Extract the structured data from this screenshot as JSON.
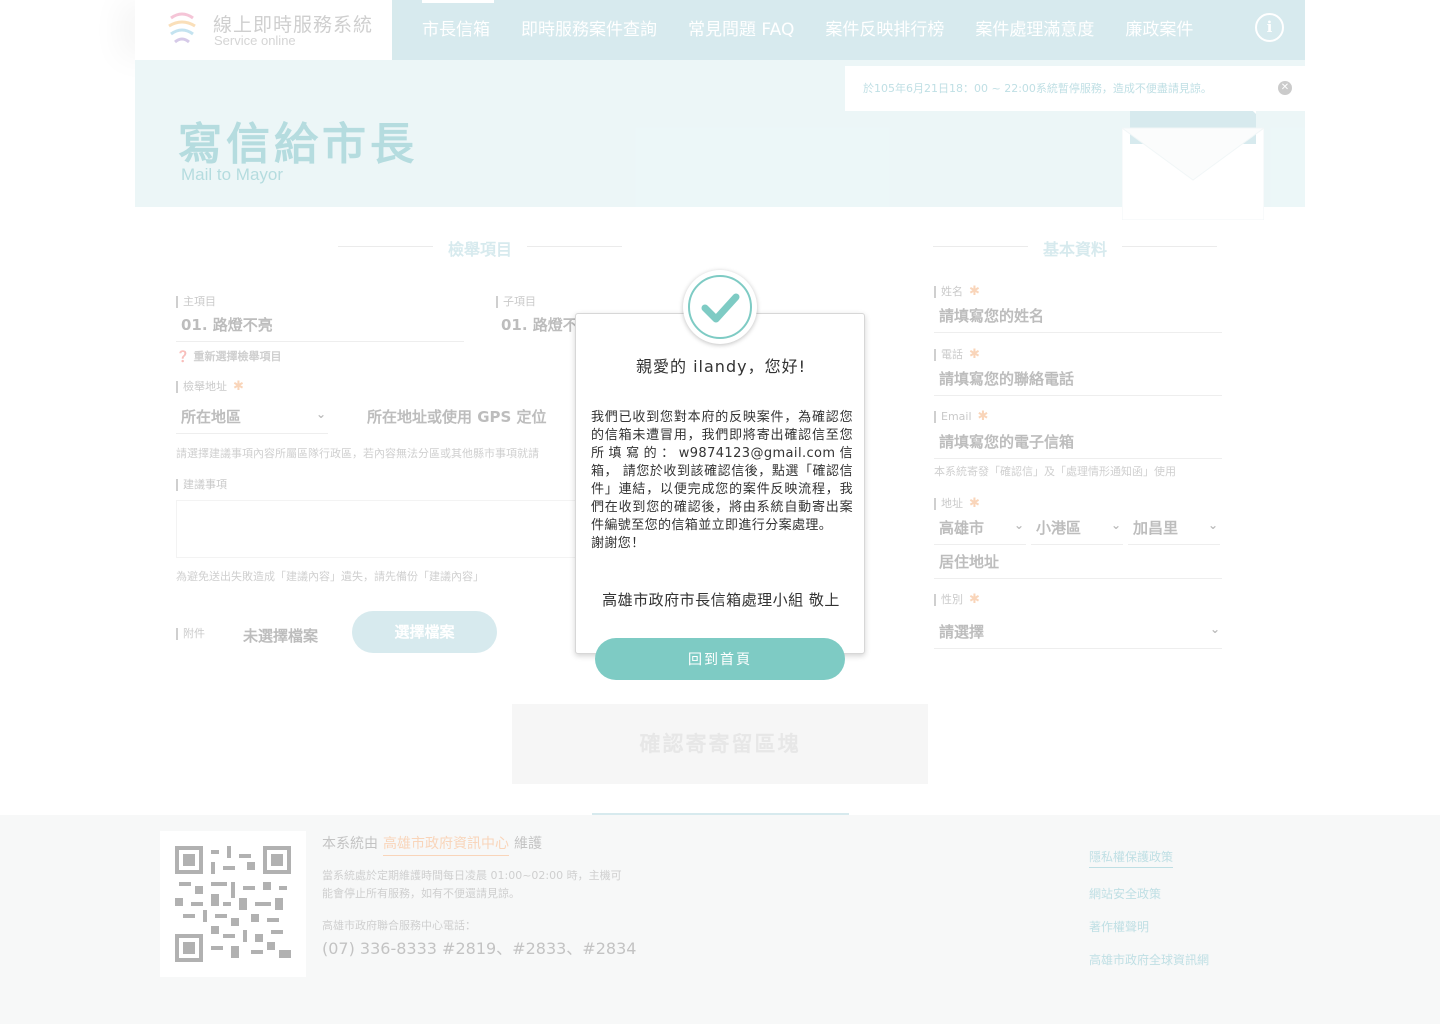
{
  "header": {
    "logo_title": "線上即時服務系統",
    "logo_sub": "Service online",
    "nav": [
      "市長信箱",
      "即時服務案件查詢",
      "常見問題 FAQ",
      "案件反映排行榜",
      "案件處理滿意度",
      "廉政案件"
    ],
    "info_icon": "i"
  },
  "hero": {
    "title": "寫信給市長",
    "subtitle": "Mail to Mayor",
    "notice": "於105年6月21日18：00 ~ 22:00系統暫停服務，造成不便盡請見諒。"
  },
  "form": {
    "left_section": "檢舉項目",
    "right_section": "基本資料",
    "main_item_label": "主項目",
    "main_item_value": "01. 路燈不亮",
    "sub_item_label": "子項目",
    "sub_item_value": "01. 路燈不",
    "reselect": "重新選擇檢舉項目",
    "address_label": "檢舉地址",
    "district_select": "所在地區",
    "gps_text": "所在地址或使用 GPS 定位",
    "address_note": "請選擇建議事項內容所屬區隊行政區，若內容無法分區或其他縣市事項就請",
    "suggest_label": "建議事項",
    "suggest_note": "為避免送出失敗造成「建議內容」遺失，請先備份「建議內容」",
    "attach_label": "附件",
    "no_file": "未選擇檔案",
    "choose_file": "選擇檔案",
    "submit_area": "確認寄寄留區塊",
    "name_label": "姓名",
    "name_placeholder": "請填寫您的姓名",
    "phone_label": "電話",
    "phone_placeholder": "請填寫您的聯絡電話",
    "email_label": "Email",
    "email_placeholder": "請填寫您的電子信箱",
    "email_note": "本系統寄發「確認信」及「處理情形通知函」使用",
    "addr_label": "地址",
    "city": "高雄市",
    "district": "小港區",
    "village": "加昌里",
    "residence": "居住地址",
    "gender_label": "性別",
    "gender_select": "請選擇"
  },
  "modal": {
    "greeting": "親愛的 ilandy，您好!",
    "body": "我們已收到您對本府的反映案件，為確認您的信箱未遭冒用，我們即將寄出確認信至您所填寫的：w9874123@gmail.com信箱， 請您於收到該確認信後，點選「確認信件」連結，以便完成您的案件反映流程，我們在收到您的確認後，將由系統自動寄出案件編號至您的信箱並立即進行分案處理。",
    "thanks": "謝謝您！",
    "signature": "高雄市政府市長信箱處理小組 敬上",
    "home_button": "回到首頁"
  },
  "footer": {
    "maintained_prefix": "本系統由",
    "maintained_link": "高雄市政府資訊中心",
    "maintained_suffix": "維護",
    "maint_note": "當系統處於定期維護時間每日凌晨 01:00~02:00 時，主機可能會停止所有服務，如有不便還請見諒。",
    "phone_label": "高雄市政府聯合服務中心電話：",
    "phone": "(07) 336-8333 #2819、#2833、#2834",
    "links": [
      "隱私權保護政策",
      "網站安全政策",
      "著作權聲明",
      "高雄市政府全球資訊網"
    ]
  },
  "colors": {
    "primary": "#8fc6cf",
    "button": "#7ecbc4",
    "accent": "#f08a3c",
    "link": "#4aa6b5"
  }
}
